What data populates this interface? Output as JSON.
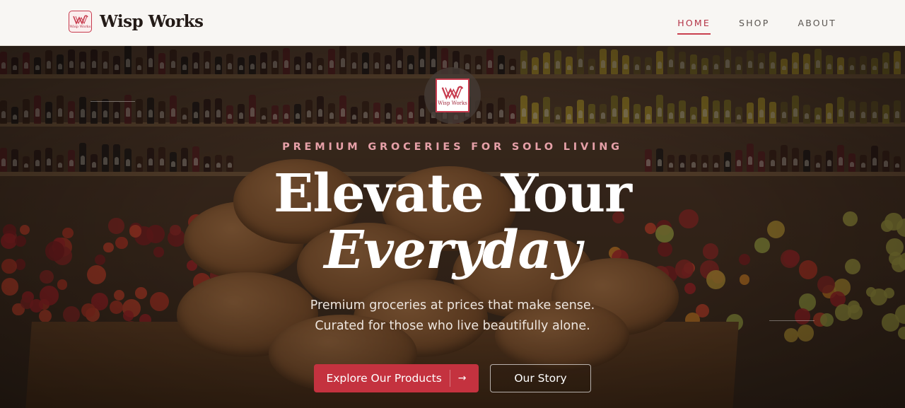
{
  "brand": {
    "name": "Wisp Works",
    "logo_text": "Wisp Works"
  },
  "nav": {
    "items": [
      {
        "label": "HOME",
        "active": true
      },
      {
        "label": "SHOP",
        "active": false
      },
      {
        "label": "ABOUT",
        "active": false
      }
    ]
  },
  "hero": {
    "logo_text": "Wisp Works",
    "eyebrow": "PREMIUM GROCERIES FOR SOLO LIVING",
    "headline_line1": "Elevate Your",
    "headline_line2": "Everyday",
    "subtitle_line1": "Premium groceries at prices that make sense.",
    "subtitle_line2": "Curated for those who live beautifully alone.",
    "primary_button": "Explore Our Products",
    "primary_button_icon": "arrow-right-icon",
    "secondary_button": "Our Story"
  },
  "colors": {
    "accent": "#c4323f",
    "eyebrow": "#e6a0a8",
    "nav_background": "#f8f6f3"
  }
}
